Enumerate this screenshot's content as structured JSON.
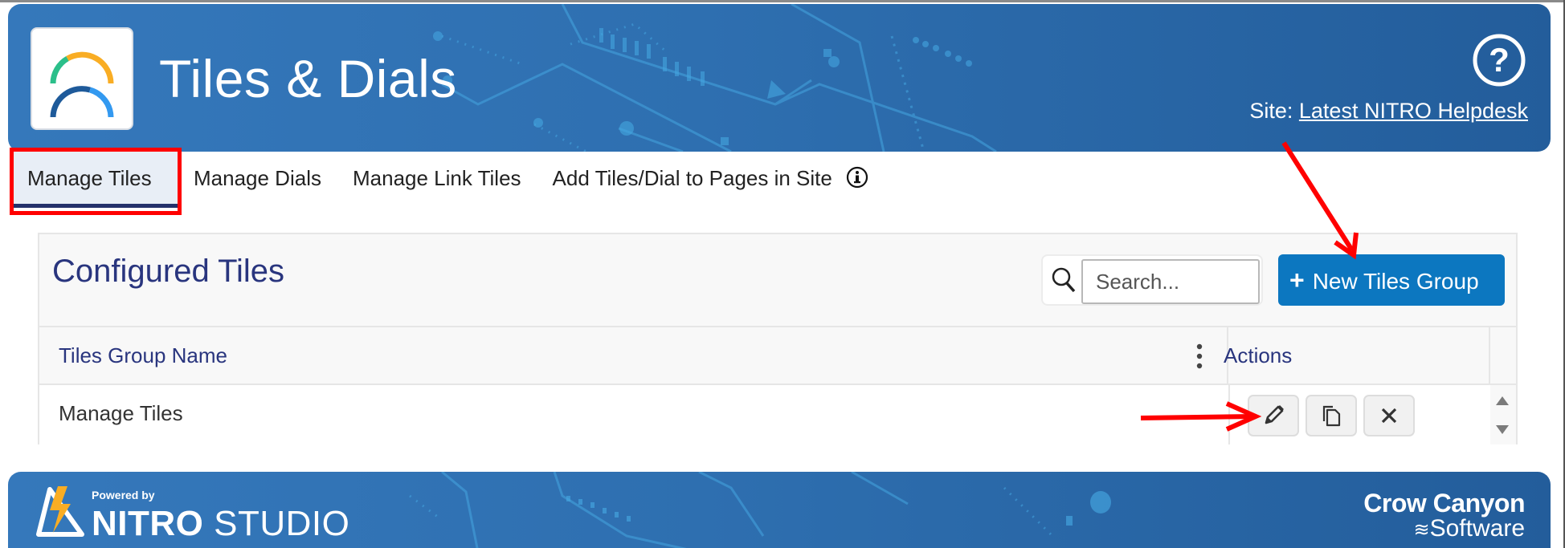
{
  "header": {
    "app_title": "Tiles & Dials",
    "site_label": "Site:",
    "site_link": "Latest NITRO Helpdesk",
    "logo_icon": "tiles-dials-logo-icon",
    "help_icon": "help-circle-icon"
  },
  "tabs": [
    {
      "label": "Manage Tiles",
      "active": true
    },
    {
      "label": "Manage Dials",
      "active": false
    },
    {
      "label": "Manage Link Tiles",
      "active": false
    },
    {
      "label": "Add Tiles/Dial to Pages in Site",
      "active": false,
      "icon": "info-icon"
    }
  ],
  "panel": {
    "title": "Configured Tiles",
    "search": {
      "placeholder": "Search...",
      "value": ""
    },
    "new_button": {
      "icon": "plus-icon",
      "label": "New Tiles Group"
    }
  },
  "grid": {
    "columns": [
      "Tiles Group Name",
      "Actions"
    ],
    "rows": [
      {
        "name": "Manage Tiles",
        "actions": [
          "edit-icon",
          "copy-icon",
          "delete-icon"
        ]
      }
    ]
  },
  "footer": {
    "powered_by": "Powered by",
    "brand_bold": "NITRO",
    "brand_light": "STUDIO",
    "company_line1": "Crow Canyon",
    "company_line2": "Software"
  },
  "colors": {
    "header_blue": "#2e6fb0",
    "primary_button": "#0c77c0",
    "title_navy": "#29357e",
    "annotation_red": "#ff0000"
  }
}
